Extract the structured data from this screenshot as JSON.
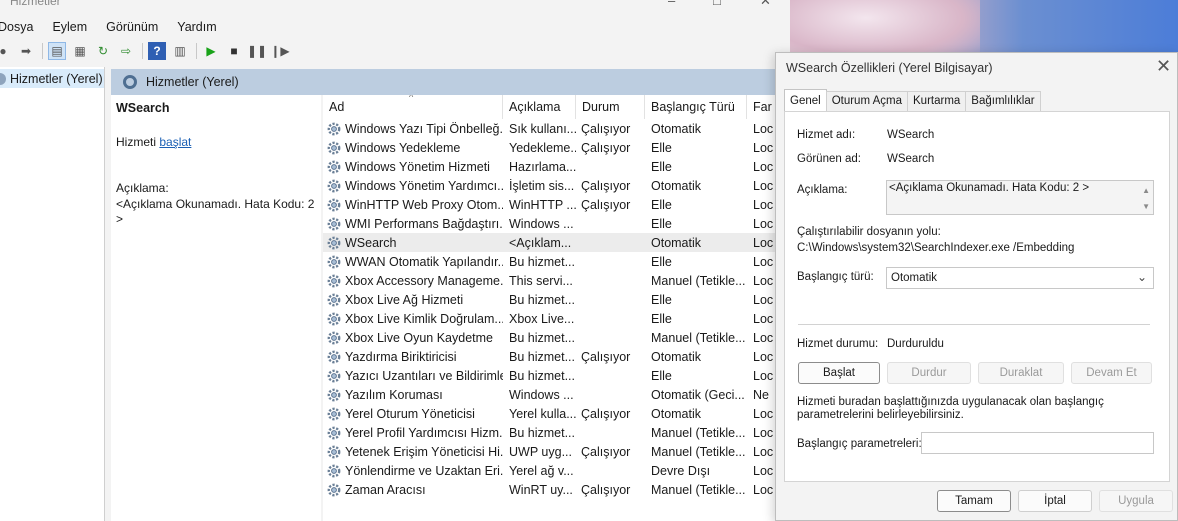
{
  "main_window": {
    "title": "Hizmetler",
    "menu": [
      "Dosya",
      "Eylem",
      "Görünüm",
      "Yardım"
    ],
    "tree_item": "Hizmetler (Yerel)",
    "pane_header": "Hizmetler (Yerel)"
  },
  "detail": {
    "service_name": "WSearch",
    "start_prefix": "Hizmeti",
    "start_link": "başlat",
    "desc_label": "Açıklama:",
    "desc_text": "<Açıklama Okunamadı. Hata Kodu: 2 >"
  },
  "list": {
    "columns": [
      "Ad",
      "Açıklama",
      "Durum",
      "Başlangıç Türü",
      "Far"
    ],
    "rows": [
      {
        "name": "Windows Yazı Tipi Önbelleğ...",
        "desc": "Sık kullanı...",
        "status": "Çalışıyor",
        "startup": "Otomatik",
        "logon": "Loc"
      },
      {
        "name": "Windows Yedekleme",
        "desc": "Yedekleme...",
        "status": "Çalışıyor",
        "startup": "Elle",
        "logon": "Loc"
      },
      {
        "name": "Windows Yönetim Hizmeti",
        "desc": "Hazırlama...",
        "status": "",
        "startup": "Elle",
        "logon": "Loc"
      },
      {
        "name": "Windows Yönetim Yardımcı...",
        "desc": "İşletim sis...",
        "status": "Çalışıyor",
        "startup": "Otomatik",
        "logon": "Loc"
      },
      {
        "name": "WinHTTP Web Proxy Otom...",
        "desc": "WinHTTP ...",
        "status": "Çalışıyor",
        "startup": "Elle",
        "logon": "Loc"
      },
      {
        "name": "WMI Performans Bağdaştırı...",
        "desc": "Windows ...",
        "status": "",
        "startup": "Elle",
        "logon": "Loc"
      },
      {
        "name": "WSearch",
        "desc": "<Açıklam...",
        "status": "",
        "startup": "Otomatik",
        "logon": "Loc"
      },
      {
        "name": "WWAN Otomatik Yapılandır...",
        "desc": "Bu hizmet...",
        "status": "",
        "startup": "Elle",
        "logon": "Loc"
      },
      {
        "name": "Xbox Accessory Manageme...",
        "desc": "This servi...",
        "status": "",
        "startup": "Manuel (Tetikle...",
        "logon": "Loc"
      },
      {
        "name": "Xbox Live Ağ Hizmeti",
        "desc": "Bu hizmet...",
        "status": "",
        "startup": "Elle",
        "logon": "Loc"
      },
      {
        "name": "Xbox Live Kimlik Doğrulam...",
        "desc": "Xbox Live...",
        "status": "",
        "startup": "Elle",
        "logon": "Loc"
      },
      {
        "name": "Xbox Live Oyun Kaydetme",
        "desc": "Bu hizmet...",
        "status": "",
        "startup": "Manuel (Tetikle...",
        "logon": "Loc"
      },
      {
        "name": "Yazdırma Biriktiricisi",
        "desc": "Bu hizmet...",
        "status": "Çalışıyor",
        "startup": "Otomatik",
        "logon": "Loc"
      },
      {
        "name": "Yazıcı Uzantıları ve Bildirimleri",
        "desc": "Bu hizmet...",
        "status": "",
        "startup": "Elle",
        "logon": "Loc"
      },
      {
        "name": "Yazılım Koruması",
        "desc": "Windows ...",
        "status": "",
        "startup": "Otomatik (Geci...",
        "logon": "Ne"
      },
      {
        "name": "Yerel Oturum Yöneticisi",
        "desc": "Yerel kulla...",
        "status": "Çalışıyor",
        "startup": "Otomatik",
        "logon": "Loc"
      },
      {
        "name": "Yerel Profil Yardımcısı Hizm...",
        "desc": "Bu hizmet...",
        "status": "",
        "startup": "Manuel (Tetikle...",
        "logon": "Loc"
      },
      {
        "name": "Yetenek Erişim Yöneticisi Hi...",
        "desc": "UWP uyg...",
        "status": "Çalışıyor",
        "startup": "Manuel (Tetikle...",
        "logon": "Loc"
      },
      {
        "name": "Yönlendirme ve Uzaktan Eri...",
        "desc": "Yerel ağ v...",
        "status": "",
        "startup": "Devre Dışı",
        "logon": "Loc"
      },
      {
        "name": "Zaman Aracısı",
        "desc": "WinRT uy...",
        "status": "Çalışıyor",
        "startup": "Manuel (Tetikle...",
        "logon": "Loc"
      }
    ],
    "selected_index": 6
  },
  "dialog": {
    "title": "WSearch Özellikleri (Yerel Bilgisayar)",
    "tabs": [
      "Genel",
      "Oturum Açma",
      "Kurtarma",
      "Bağımlılıklar"
    ],
    "service_name_label": "Hizmet adı:",
    "service_name": "WSearch",
    "display_name_label": "Görünen ad:",
    "display_name": "WSearch",
    "description_label": "Açıklama:",
    "description": "<Açıklama Okunamadı. Hata Kodu: 2 >",
    "exe_path_label": "Çalıştırılabilir dosyanın yolu:",
    "exe_path": "C:\\Windows\\system32\\SearchIndexer.exe /Embedding",
    "startup_type_label": "Başlangıç türü:",
    "startup_type": "Otomatik",
    "status_label": "Hizmet durumu:",
    "status": "Durduruldu",
    "btn_start": "Başlat",
    "btn_stop": "Durdur",
    "btn_pause": "Duraklat",
    "btn_resume": "Devam Et",
    "hint": "Hizmeti buradan başlattığınızda uygulanacak olan başlangıç parametrelerini belirleyebilirsiniz.",
    "params_label": "Başlangıç parametreleri:",
    "btn_ok": "Tamam",
    "btn_cancel": "İptal",
    "btn_apply": "Uygula"
  }
}
